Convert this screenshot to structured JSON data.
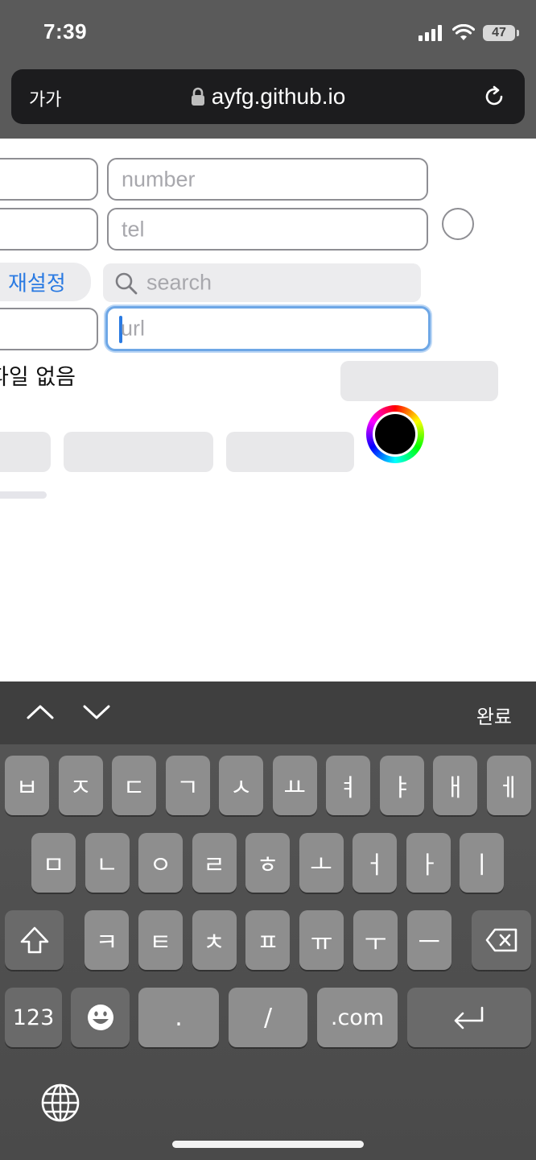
{
  "status": {
    "time": "7:39",
    "battery": "47"
  },
  "browser": {
    "text_size_label": "가가",
    "url": "ayfg.github.io"
  },
  "form": {
    "number_placeholder": "number",
    "tel_placeholder": "tel",
    "reset_label": "재설정",
    "search_placeholder": "search",
    "url_placeholder": "url",
    "file_status": "파일 없음"
  },
  "accessory": {
    "done_label": "완료"
  },
  "keyboard": {
    "row1": [
      "ㅂ",
      "ㅈ",
      "ㄷ",
      "ㄱ",
      "ㅅ",
      "ㅛ",
      "ㅕ",
      "ㅑ",
      "ㅐ",
      "ㅔ"
    ],
    "row2": [
      "ㅁ",
      "ㄴ",
      "ㅇ",
      "ㄹ",
      "ㅎ",
      "ㅗ",
      "ㅓ",
      "ㅏ",
      "ㅣ"
    ],
    "row3": [
      "ㅋ",
      "ㅌ",
      "ㅊ",
      "ㅍ",
      "ㅠ",
      "ㅜ",
      "ㅡ"
    ],
    "numbers_label": "123",
    "period_label": ".",
    "slash_label": "/",
    "dotcom_label": ".com"
  }
}
